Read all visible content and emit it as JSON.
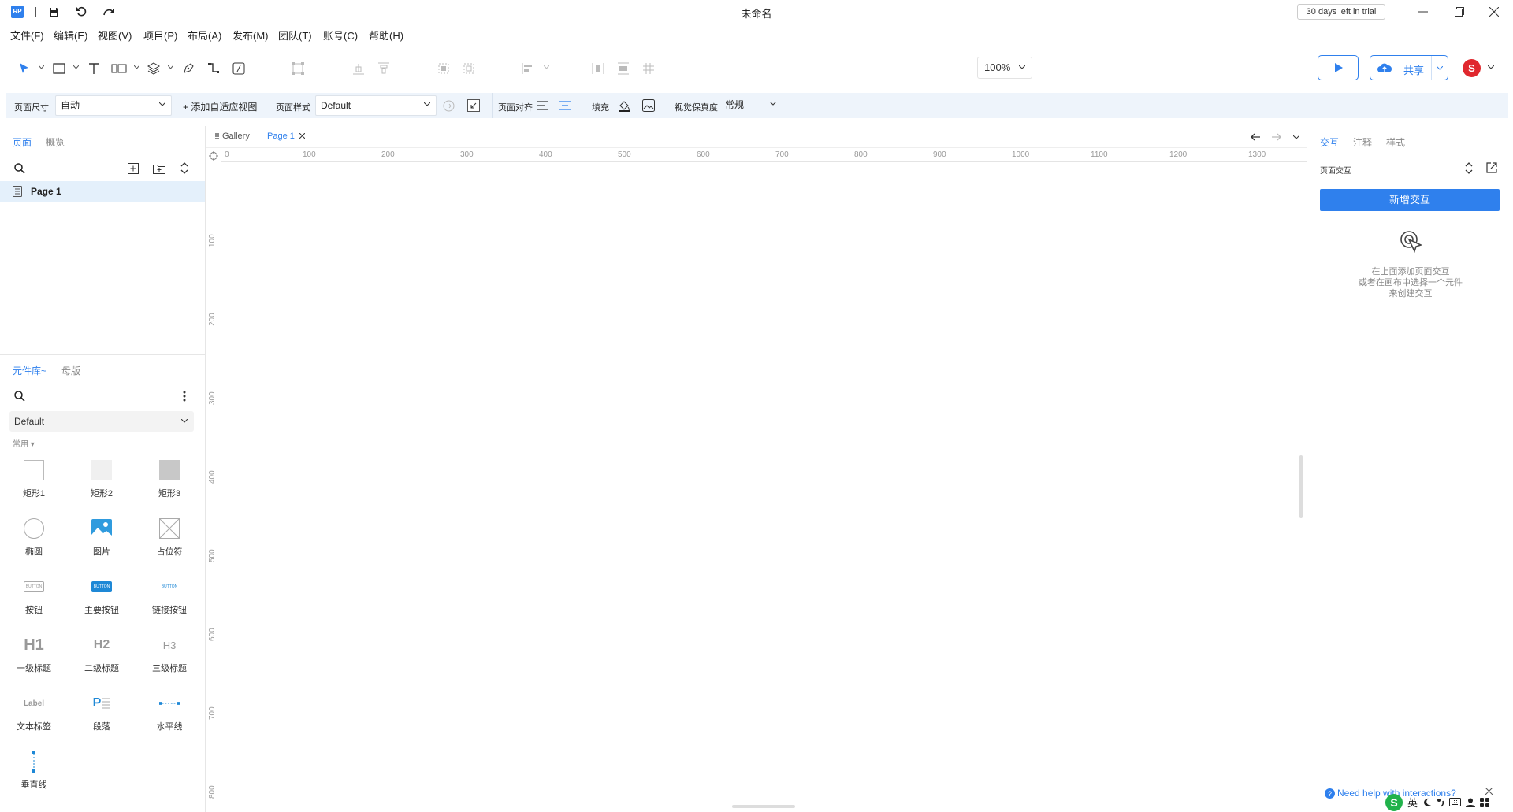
{
  "title": "未命名",
  "trial_badge": "30 days left in trial",
  "menu": [
    "文件(F)",
    "编辑(E)",
    "视图(V)",
    "项目(P)",
    "布局(A)",
    "发布(M)",
    "团队(T)",
    "账号(C)",
    "帮助(H)"
  ],
  "toolbar": {
    "zoom": "100%",
    "share_label": "共享",
    "avatar_letter": "S"
  },
  "stylebar": {
    "page_size_label": "页面尺寸",
    "page_size_value": "自动",
    "add_adaptive_view": "+ 添加自适应视图",
    "page_style_label": "页面样式",
    "page_style_value": "Default",
    "page_align_label": "页面对齐",
    "fill_label": "填充",
    "fidelity_label": "视觉保真度",
    "fidelity_value": "常规"
  },
  "left_panel": {
    "tabs": [
      "页面",
      "概览"
    ],
    "pages": [
      "Page 1"
    ],
    "library_tabs": [
      "元件库~",
      "母版"
    ],
    "library_select": "Default",
    "category": "常用 ▾",
    "widgets": [
      "矩形1",
      "矩形2",
      "矩形3",
      "椭圆",
      "图片",
      "占位符",
      "按钮",
      "主要按钮",
      "链接按钮",
      "一级标题",
      "二级标题",
      "三级标题",
      "文本标签",
      "段落",
      "水平线",
      "垂直线"
    ],
    "widget_glyph_text": {
      "button": "BUTTON",
      "h1": "H1",
      "h2": "H2",
      "h3": "H3",
      "label": "Label",
      "paragraph": "P"
    }
  },
  "canvas": {
    "tabs": [
      "Gallery",
      "Page 1"
    ],
    "ruler_h": [
      "0",
      "100",
      "200",
      "300",
      "400",
      "500",
      "600",
      "700",
      "800",
      "900",
      "1000",
      "1100",
      "1200",
      "1300"
    ],
    "ruler_v": [
      "100",
      "200",
      "300",
      "400",
      "500",
      "600",
      "700",
      "800"
    ]
  },
  "right_panel": {
    "tabs": [
      "交互",
      "注释",
      "样式"
    ],
    "page_interaction_label": "页面交互",
    "add_interaction": "新增交互",
    "hint_lines": [
      "在上面添加页面交互",
      "或者在画布中选择一个元件",
      "来创建交互"
    ],
    "help_link": "Need help with interactions?"
  },
  "ime": {
    "lang": "英"
  },
  "colors": {
    "accent": "#2f80ed",
    "selection_bg": "#e4f0fb",
    "stylebar_bg": "#eef4fb",
    "avatar": "#e0282e"
  }
}
